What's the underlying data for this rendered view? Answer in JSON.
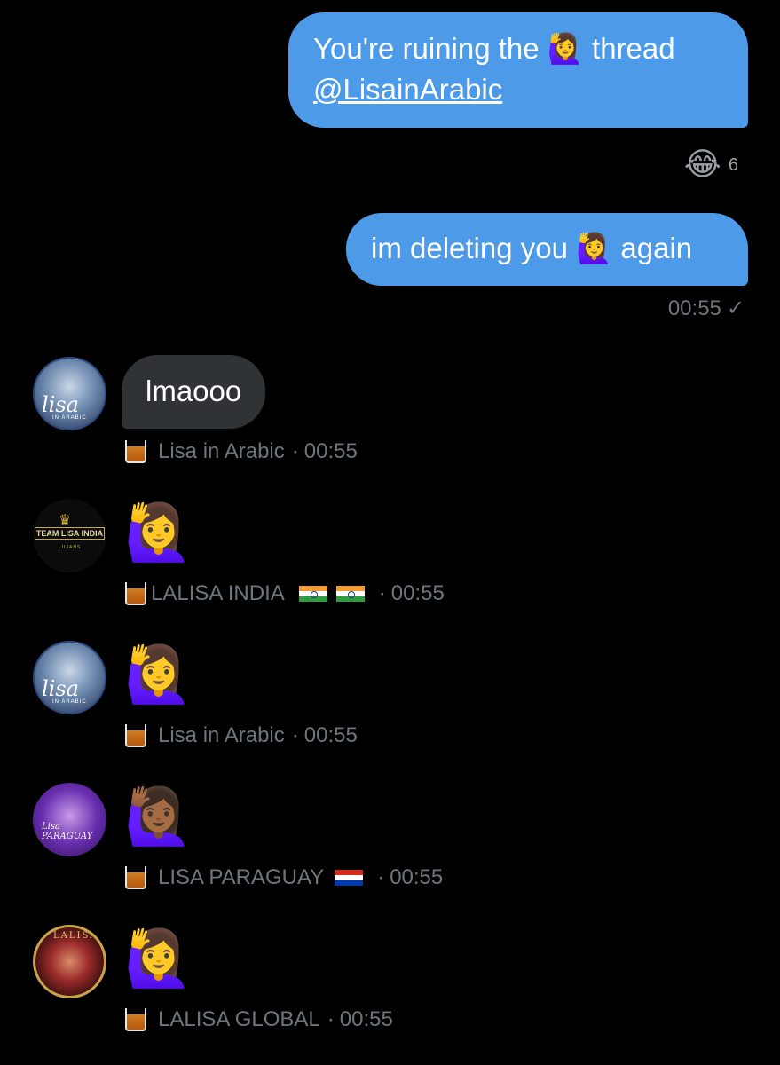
{
  "outgoing": [
    {
      "text_before": "You're ruining the",
      "emoji": "🙋‍♀️",
      "text_after": "thread",
      "mention": "@LisainArabic"
    },
    {
      "text_before": "im deleting you",
      "emoji": "🙋‍♀️",
      "text_after": "again"
    }
  ],
  "reaction": {
    "emoji": "😂",
    "count": "6"
  },
  "outgoing_status": {
    "time": "00:55",
    "check": "✓"
  },
  "incoming": [
    {
      "kind": "text",
      "text": "lmaooo",
      "name": "Lisa in Arabic",
      "flags": "",
      "time": "00:55",
      "avatar": "lisa-in-arabic"
    },
    {
      "kind": "emoji",
      "emoji": "🙋‍♀️",
      "name": "LALISA INDIA",
      "flags": "🇮🇳 🇮🇳",
      "time": "00:55",
      "avatar": "team-lisa-india"
    },
    {
      "kind": "emoji",
      "emoji": "🙋‍♀️",
      "name": "Lisa in Arabic",
      "flags": "",
      "time": "00:55",
      "avatar": "lisa-in-arabic"
    },
    {
      "kind": "emoji",
      "emoji": "🙋🏾‍♀️",
      "name": "LISA PARAGUAY",
      "flags": "🇵🇾",
      "time": "00:55",
      "avatar": "lisa-paraguay"
    },
    {
      "kind": "emoji",
      "emoji": "🙋‍♀️",
      "name": "LALISA GLOBAL",
      "flags": "",
      "time": "00:55",
      "avatar": "lalisa-global"
    }
  ],
  "separator": "·",
  "avatar_text": {
    "arabic_logo": "lisa",
    "arabic_sub": "IN ARABIC",
    "india_logo": "TEAM LISA INDIA",
    "india_sub": "LILIANS",
    "paraguay_logo": "Lisa PARAGUAY",
    "global_logo": "LALISA"
  },
  "colors": {
    "background": "#000000",
    "outgoing_bubble": "#4d9be8",
    "incoming_bubble": "#2f3336",
    "meta_text": "#6e767d"
  }
}
